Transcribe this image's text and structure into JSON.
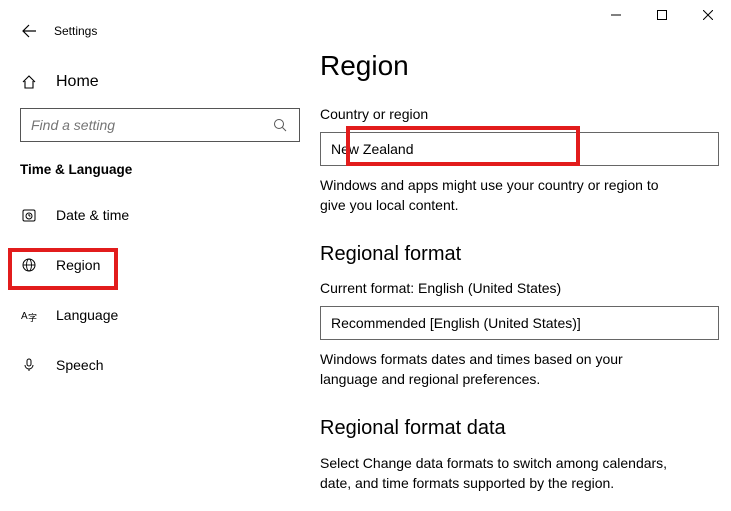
{
  "titlebar": {
    "app_name": "Settings"
  },
  "sidebar": {
    "home_label": "Home",
    "search_placeholder": "Find a setting",
    "section_title": "Time & Language",
    "items": [
      {
        "label": "Date & time"
      },
      {
        "label": "Region"
      },
      {
        "label": "Language"
      },
      {
        "label": "Speech"
      }
    ]
  },
  "main": {
    "title": "Region",
    "country_label": "Country or region",
    "country_value": "New Zealand",
    "country_helper": "Windows and apps might use your country or region to give you local content.",
    "format_heading": "Regional format",
    "current_format_label": "Current format: English (United States)",
    "format_value": "Recommended [English (United States)]",
    "format_helper": "Windows formats dates and times based on your language and regional preferences.",
    "data_heading": "Regional format data",
    "data_helper": "Select Change data formats to switch among calendars, date, and time formats supported by the region."
  }
}
